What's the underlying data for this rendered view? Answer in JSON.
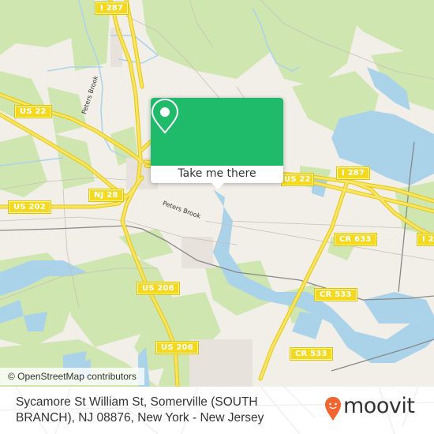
{
  "map": {
    "attribution": "© OpenStreetMap contributors",
    "colors": {
      "land": "#f2efe9",
      "forest": "#cfe6b0",
      "water": "#aad3ea",
      "highway": "#f5d921",
      "rail": "#888888",
      "urban": "#e8e2dc"
    },
    "road_shields": [
      {
        "label": "I 287"
      },
      {
        "label": "US 22"
      },
      {
        "label": "US 202"
      },
      {
        "label": "NJ 28"
      },
      {
        "label": "I 287"
      },
      {
        "label": "US 22"
      },
      {
        "label": "US 206"
      },
      {
        "label": "US 206"
      },
      {
        "label": "CR 633"
      },
      {
        "label": "CR 533"
      },
      {
        "label": "CR 533"
      },
      {
        "label": "I 2"
      }
    ],
    "street_labels": [
      {
        "label": "Peters Brook"
      },
      {
        "label": "Peters Brook"
      }
    ]
  },
  "popup": {
    "icon": "map-pin-icon",
    "action_label": "Take me there",
    "accent": "#1fba6a"
  },
  "footer": {
    "address": "Sycamore St William St, Somerville (SOUTH BRANCH), NJ 08876, New York - New Jersey",
    "brand": "moovit",
    "brand_color": "#f26530"
  }
}
